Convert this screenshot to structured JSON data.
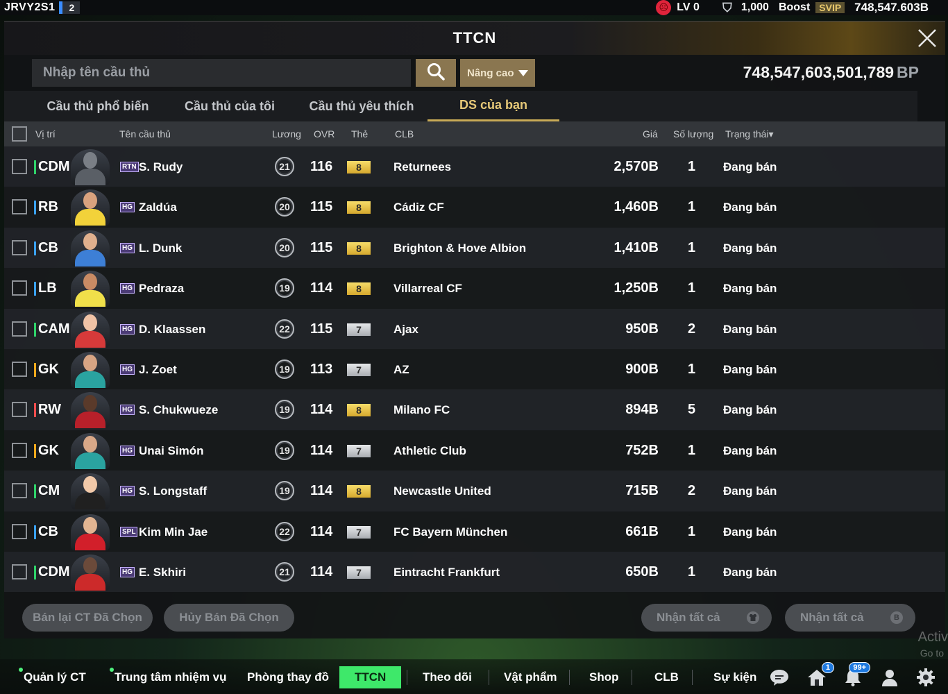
{
  "topbar": {
    "user_id": "JRVY2S1",
    "server": "2",
    "level": "LV 0",
    "coins": "1,000",
    "boost_label": "Boost",
    "svip_label": "SVIP",
    "bp_short": "748,547.603B"
  },
  "window": {
    "title": "TTCN",
    "search_placeholder": "Nhập tên cầu thủ",
    "advanced_label": "Nâng cao",
    "bp_balance": "748,547,603,501,789",
    "bp_unit": "BP"
  },
  "tabs": [
    {
      "label": "Cầu thủ phổ biến"
    },
    {
      "label": "Cầu thủ của tôi"
    },
    {
      "label": "Cầu thủ yêu thích"
    },
    {
      "label": "DS của bạn"
    }
  ],
  "columns": {
    "position": "Vị trí",
    "name": "Tên cầu thủ",
    "wage": "Lương",
    "ovr": "OVR",
    "grade": "Thẻ",
    "club": "CLB",
    "price": "Giá",
    "quantity": "Số lượng",
    "status": "Trạng thái"
  },
  "rows": [
    {
      "pos": "CDM",
      "pos_color": "#2fd36a",
      "season": "RTN",
      "name": "S. Rudy",
      "wage": "21",
      "ovr": "116",
      "grade": "8",
      "grade_tier": "gold",
      "club": "Returnees",
      "price": "2,570B",
      "qty": "1",
      "status": "Đang bán"
    },
    {
      "pos": "RB",
      "pos_color": "#3aa2ff",
      "season": "HG",
      "name": "Zaldúa",
      "wage": "20",
      "ovr": "115",
      "grade": "8",
      "grade_tier": "gold",
      "club": "Cádiz CF",
      "price": "1,460B",
      "qty": "1",
      "status": "Đang bán"
    },
    {
      "pos": "CB",
      "pos_color": "#3aa2ff",
      "season": "HG",
      "name": "L. Dunk",
      "wage": "20",
      "ovr": "115",
      "grade": "8",
      "grade_tier": "gold",
      "club": "Brighton & Hove Albion",
      "price": "1,410B",
      "qty": "1",
      "status": "Đang bán"
    },
    {
      "pos": "LB",
      "pos_color": "#3aa2ff",
      "season": "HG",
      "name": "Pedraza",
      "wage": "19",
      "ovr": "114",
      "grade": "8",
      "grade_tier": "gold",
      "club": "Villarreal CF",
      "price": "1,250B",
      "qty": "1",
      "status": "Đang bán"
    },
    {
      "pos": "CAM",
      "pos_color": "#2fd36a",
      "season": "HG",
      "name": "D. Klaassen",
      "wage": "22",
      "ovr": "115",
      "grade": "7",
      "grade_tier": "silver",
      "club": "Ajax",
      "price": "950B",
      "qty": "2",
      "status": "Đang bán"
    },
    {
      "pos": "GK",
      "pos_color": "#f0a91c",
      "season": "HG",
      "name": "J. Zoet",
      "wage": "19",
      "ovr": "113",
      "grade": "7",
      "grade_tier": "silver",
      "club": "AZ",
      "price": "900B",
      "qty": "1",
      "status": "Đang bán"
    },
    {
      "pos": "RW",
      "pos_color": "#ff4d4d",
      "season": "HG",
      "name": "S. Chukwueze",
      "wage": "19",
      "ovr": "114",
      "grade": "8",
      "grade_tier": "gold",
      "club": "Milano FC",
      "price": "894B",
      "qty": "5",
      "status": "Đang bán"
    },
    {
      "pos": "GK",
      "pos_color": "#f0a91c",
      "season": "HG",
      "name": "Unai Simón",
      "wage": "19",
      "ovr": "114",
      "grade": "7",
      "grade_tier": "silver",
      "club": "Athletic Club",
      "price": "752B",
      "qty": "1",
      "status": "Đang bán"
    },
    {
      "pos": "CM",
      "pos_color": "#2fd36a",
      "season": "HG",
      "name": "S. Longstaff",
      "wage": "19",
      "ovr": "114",
      "grade": "8",
      "grade_tier": "gold",
      "club": "Newcastle United",
      "price": "715B",
      "qty": "2",
      "status": "Đang bán"
    },
    {
      "pos": "CB",
      "pos_color": "#3aa2ff",
      "season": "SPL",
      "name": "Kim Min Jae",
      "wage": "22",
      "ovr": "114",
      "grade": "7",
      "grade_tier": "silver",
      "club": "FC Bayern München",
      "price": "661B",
      "qty": "1",
      "status": "Đang bán"
    },
    {
      "pos": "CDM",
      "pos_color": "#2fd36a",
      "season": "HG",
      "name": "E. Skhiri",
      "wage": "21",
      "ovr": "114",
      "grade": "7",
      "grade_tier": "silver",
      "club": "Eintracht Frankfurt",
      "price": "650B",
      "qty": "1",
      "status": "Đang bán"
    }
  ],
  "actions": {
    "resell_selected": "Bán lại CT Đã Chọn",
    "cancel_selected": "Hủy Bán Đã Chọn",
    "claim_all_players": "Nhận tất cả",
    "claim_all_bp": "Nhận tất cả"
  },
  "watermark": {
    "line1": "Activ",
    "line2": "Go to"
  },
  "nav": {
    "items": [
      {
        "label": "Quản lý CT"
      },
      {
        "label": "Trung tâm nhiệm vụ"
      },
      {
        "label": "Phòng thay đồ"
      },
      {
        "label": "TTCN"
      },
      {
        "label": "Theo dõi"
      },
      {
        "label": "Vật phẩm"
      },
      {
        "label": "Shop"
      },
      {
        "label": "CLB"
      },
      {
        "label": "Sự kiện"
      }
    ],
    "home_badge": "1",
    "bell_badge": "99+"
  },
  "colors": {
    "accent_gold": "#c9ab57",
    "active_nav": "#3ee86a",
    "grade_gold": "#e8c04a",
    "grade_silver": "#c4c7cb"
  },
  "icons": [
    "sad-face-icon",
    "shield-icon",
    "close-icon",
    "search-icon",
    "chevron-down-icon",
    "jersey-icon",
    "coin-icon",
    "chat-icon",
    "home-icon",
    "bell-icon",
    "profile-icon",
    "gear-icon"
  ]
}
